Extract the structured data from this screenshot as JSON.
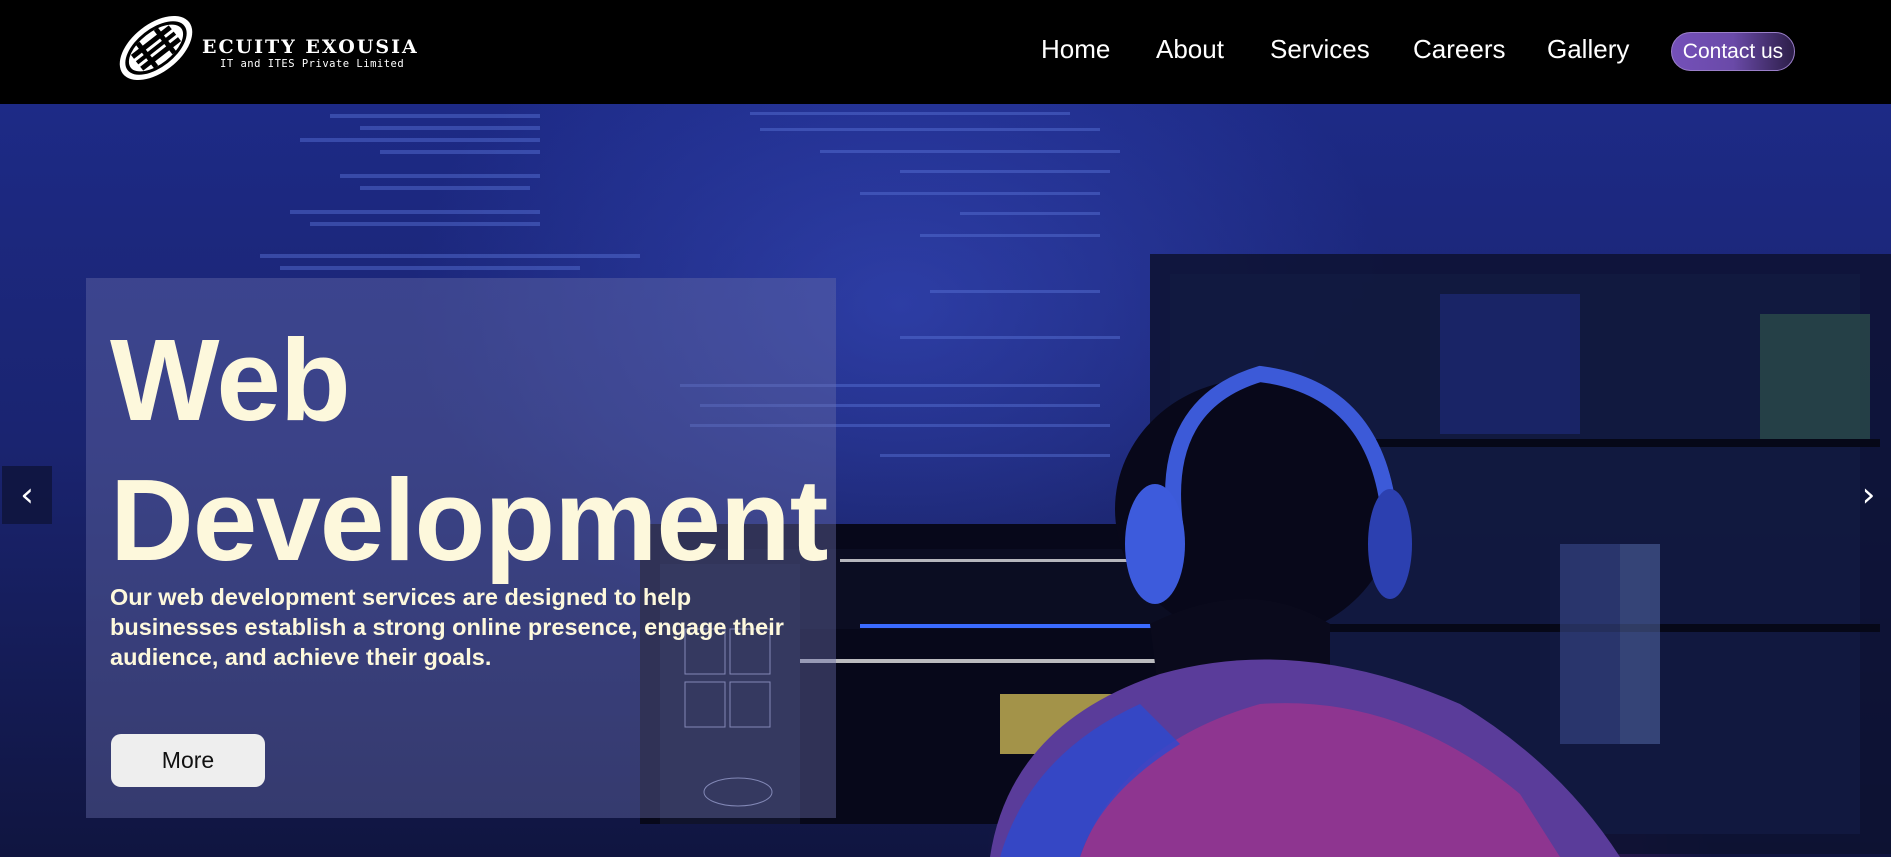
{
  "brand": {
    "name": "ECUITY EXOUSIA",
    "tagline": "IT and ITES Private Limited",
    "logo_icon": "rugby-ball-logo-icon"
  },
  "nav": {
    "items": [
      {
        "label": "Home"
      },
      {
        "label": "About"
      },
      {
        "label": "Services"
      },
      {
        "label": "Careers"
      },
      {
        "label": "Gallery"
      }
    ],
    "contact_label": "Contact us"
  },
  "hero": {
    "title_line1": "Web",
    "title_line2": "Development",
    "description": "Our web development services are designed to help businesses establish a strong online presence, engage their audience, and achieve their goals.",
    "button_label": "More",
    "prev_arrow": "‹",
    "next_arrow": "›"
  },
  "colors": {
    "nav_bg": "#000000",
    "contact_accent": "#7450b9",
    "hero_text": "#fdf8dc",
    "hero_bg": "#1d2a86"
  }
}
